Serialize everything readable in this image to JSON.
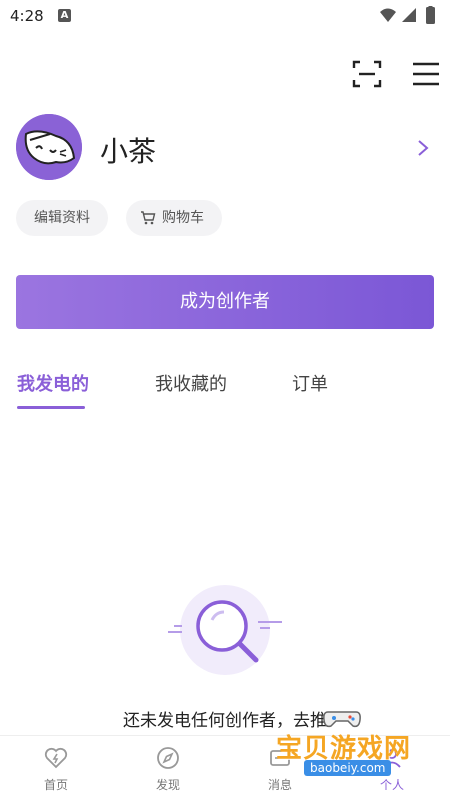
{
  "status_bar": {
    "time": "4:28",
    "app_badge": "A"
  },
  "profile": {
    "username": "小茶"
  },
  "actions": {
    "edit_label": "编辑资料",
    "cart_label": "购物车"
  },
  "cta": {
    "label": "成为创作者"
  },
  "tabs": [
    {
      "label": "我发电的",
      "active": true
    },
    {
      "label": "我收藏的",
      "active": false
    },
    {
      "label": "订单",
      "active": false
    }
  ],
  "empty_state": {
    "message": "还未发电任何创作者，去推"
  },
  "bottom_nav": [
    {
      "label": "首页",
      "icon": "lightning-heart-icon"
    },
    {
      "label": "发现",
      "icon": "compass-icon"
    },
    {
      "label": "消息",
      "icon": "message-icon"
    },
    {
      "label": "个人",
      "icon": "person-icon"
    }
  ],
  "watermark": {
    "text": "宝贝游戏网",
    "url": "baobeiy.com"
  },
  "colors": {
    "accent": "#8a5fd8",
    "cta_start": "#9b75e0",
    "cta_end": "#7b57d6"
  }
}
